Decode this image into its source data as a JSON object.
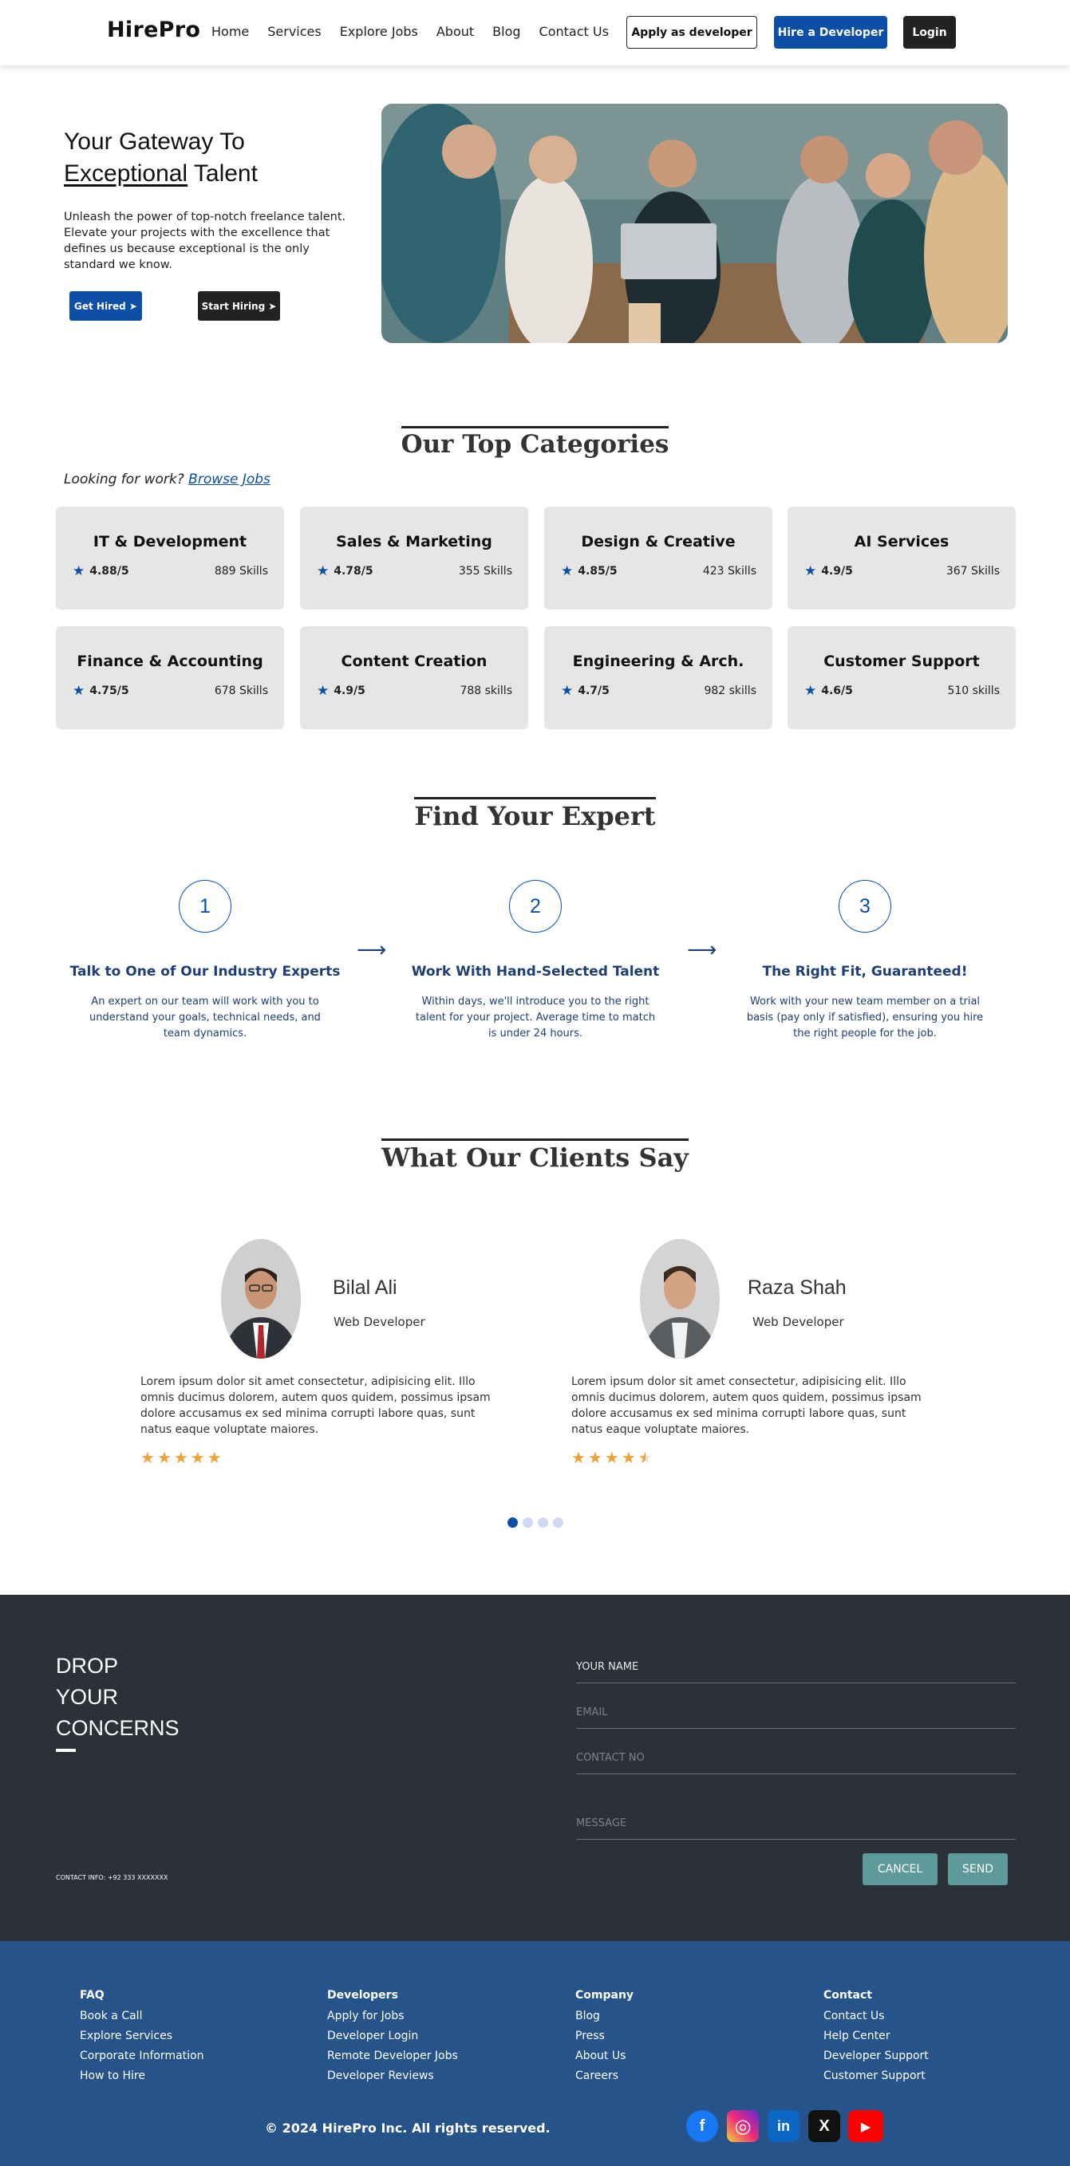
{
  "nav": {
    "logo": "HirePro",
    "links": [
      "Home",
      "Services",
      "Explore Jobs",
      "About",
      "Blog",
      "Contact Us"
    ],
    "apply_dev": "Apply as developer",
    "hire_dev": "Hire a Developer",
    "login": "Login"
  },
  "hero": {
    "title_line1": "Your Gateway To",
    "title_emph": "Exceptional",
    "title_rest": " Talent",
    "desc": "Unleash the power of top-notch freelance talent. Elevate your projects with the excellence that defines us because exceptional is the only standard we know.",
    "btn_hired": "Get Hired ➤",
    "btn_hiring": "Start Hiring ➤"
  },
  "categories": {
    "title": "Our Top Categories",
    "looking_text": "Looking for work?",
    "browse_link": "Browse Jobs",
    "items": [
      {
        "name": "IT & Development",
        "rating": "4.88/5",
        "skills": "889 Skills"
      },
      {
        "name": "Sales & Marketing",
        "rating": "4.78/5",
        "skills": "355 Skills"
      },
      {
        "name": "Design & Creative",
        "rating": "4.85/5",
        "skills": "423 Skills"
      },
      {
        "name": "AI Services",
        "rating": "4.9/5",
        "skills": "367 Skills"
      },
      {
        "name": "Finance & Accounting",
        "rating": "4.75/5",
        "skills": "678 Skills"
      },
      {
        "name": "Content Creation",
        "rating": "4.9/5",
        "skills": "788 skills"
      },
      {
        "name": "Engineering & Arch.",
        "rating": "4.7/5",
        "skills": "982 skills"
      },
      {
        "name": "Customer Support",
        "rating": "4.6/5",
        "skills": "510 skills"
      }
    ]
  },
  "expert": {
    "title": "Find Your Expert",
    "steps": [
      {
        "num": "1",
        "title": "Talk to One of Our Industry Experts",
        "desc": "An expert on our team will work with you to understand your goals, technical needs, and team dynamics."
      },
      {
        "num": "2",
        "title": "Work With Hand-Selected Talent",
        "desc": "Within days, we'll introduce you to the right talent for your project. Average time to match is under 24 hours."
      },
      {
        "num": "3",
        "title": "The Right Fit, Guaranteed!",
        "desc": "Work with your new team member on a trial basis (pay only if satisfied), ensuring you hire the right people for the job."
      }
    ],
    "arrow": "⟶"
  },
  "testimonials": {
    "title": "What Our Clients Say",
    "items": [
      {
        "name": "Bilal Ali",
        "role": "Web Developer",
        "text": "Lorem ipsum dolor sit amet consectetur, adipisicing elit. Illo omnis ducimus dolorem, autem quos quidem, possimus ipsam dolore accusamus ex sed minima corrupti labore quas, sunt natus eaque voluptate maiores.",
        "stars": "★★★★★",
        "rating": 5
      },
      {
        "name": "Raza Shah",
        "role": "Web Developer",
        "text": "Lorem ipsum dolor sit amet consectetur, adipisicing elit. Illo omnis ducimus dolorem, autem quos quidem, possimus ipsam dolore accusamus ex sed minima corrupti labore quas, sunt natus eaque voluptate maiores.",
        "stars": "★★★★★",
        "rating": 4.5
      }
    ],
    "active_dot": 1,
    "dot_count": 4
  },
  "contact": {
    "heading": [
      "DROP",
      "YOUR",
      "CONCERNS"
    ],
    "info": "CONTACT INFO: +92 333 XXXXXXX",
    "fields": [
      "YOUR NAME",
      "EMAIL",
      "CONTACT NO",
      "MESSAGE"
    ],
    "cancel": "CANCEL",
    "send": "SEND"
  },
  "footer": {
    "columns": [
      {
        "heading": "FAQ",
        "items": [
          "Book a Call",
          "Explore Services",
          "Corporate Information",
          "How to Hire"
        ]
      },
      {
        "heading": "Developers",
        "items": [
          "Apply for Jobs",
          "Developer Login",
          "Remote Developer Jobs",
          "Developer Reviews"
        ]
      },
      {
        "heading": "Company",
        "items": [
          "Blog",
          "Press",
          "About Us",
          "Careers"
        ]
      },
      {
        "heading": "Contact",
        "items": [
          "Contact Us",
          "Help Center",
          "Developer Support",
          "Customer Support"
        ]
      }
    ],
    "copyright": "© 2024 HirePro Inc. All rights reserved.",
    "social": [
      {
        "icon": "facebook-icon",
        "glyph": "f",
        "color": "#1877f2"
      },
      {
        "icon": "instagram-icon",
        "glyph": "◎",
        "color": "#d6249f"
      },
      {
        "icon": "linkedin-icon",
        "glyph": "in",
        "color": "#0a66c2"
      },
      {
        "icon": "x-icon",
        "glyph": "X",
        "color": "#111111"
      },
      {
        "icon": "youtube-icon",
        "glyph": "▶",
        "color": "#ff0000"
      }
    ]
  },
  "colors": {
    "brand_blue": "#0d4fa8",
    "dark": "#222222",
    "contact_bg": "#2c3038",
    "footer_bg": "#26538a",
    "star": "#f0a335",
    "teal_btn": "#5f9a9b"
  }
}
